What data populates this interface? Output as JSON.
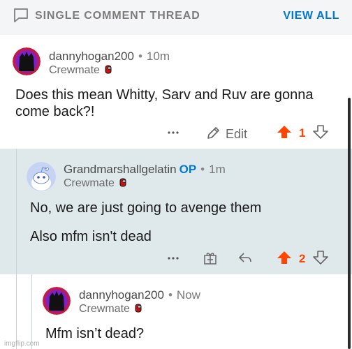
{
  "header": {
    "title": "SINGLE COMMENT THREAD",
    "view_all": "VIEW ALL"
  },
  "comments": [
    {
      "username": "dannyhogan200",
      "time": "10m",
      "flair": "Crewmate",
      "op": "",
      "body": [
        "Does this mean Whitty, Sarv and Ruv are gonna",
        "come back?!"
      ],
      "score": "1",
      "edit_label": "Edit"
    },
    {
      "username": "Grandmarshallgelatin",
      "time": "1m",
      "flair": "Crewmate",
      "op": "OP",
      "body": [
        "No, we are just going to avenge them",
        "Also mfm isn't dead"
      ],
      "score": "2"
    },
    {
      "username": "dannyhogan200",
      "time": "Now",
      "flair": "Crewmate",
      "op": "",
      "body": [
        "Mfm isn’t dead?"
      ]
    }
  ],
  "watermark": "imgflip.com",
  "colors": {
    "upvote": "#ff4500",
    "link_blue": "#0079d3",
    "band": "#dfe9ec"
  },
  "icons": {
    "thread": "comment-bubble-icon",
    "more": "more-dots-icon",
    "edit": "pencil-icon",
    "upvote": "upvote-arrow-icon",
    "downvote": "downvote-arrow-icon",
    "award": "gift-award-icon",
    "reply": "reply-arrow-icon",
    "flair": "crewmate-icon"
  }
}
